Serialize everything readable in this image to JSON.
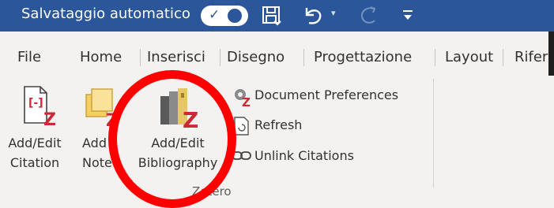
{
  "title_bar": {
    "autosave_label": "Salvataggio automatico",
    "autosave_state": "on",
    "icons": [
      "save-icon",
      "undo-icon",
      "redo-icon",
      "customize-qat-icon"
    ]
  },
  "tabs": [
    "File",
    "Home",
    "Inserisci",
    "Disegno",
    "Progettazione",
    "Layout",
    "Rifer"
  ],
  "ribbon": {
    "add_edit_citation": [
      "Add/Edit",
      "Citation"
    ],
    "add_note": [
      "Add",
      "Note"
    ],
    "add_edit_bibliography": [
      "Add/Edit",
      "Bibliography"
    ],
    "document_preferences": "Document Preferences",
    "refresh": "Refresh",
    "unlink_citations": "Unlink Citations",
    "group_label": "Zotero"
  },
  "colors": {
    "titlebar": "#2b579a",
    "zotero_red": "#cc2936",
    "highlight_circle": "#ff0000"
  }
}
